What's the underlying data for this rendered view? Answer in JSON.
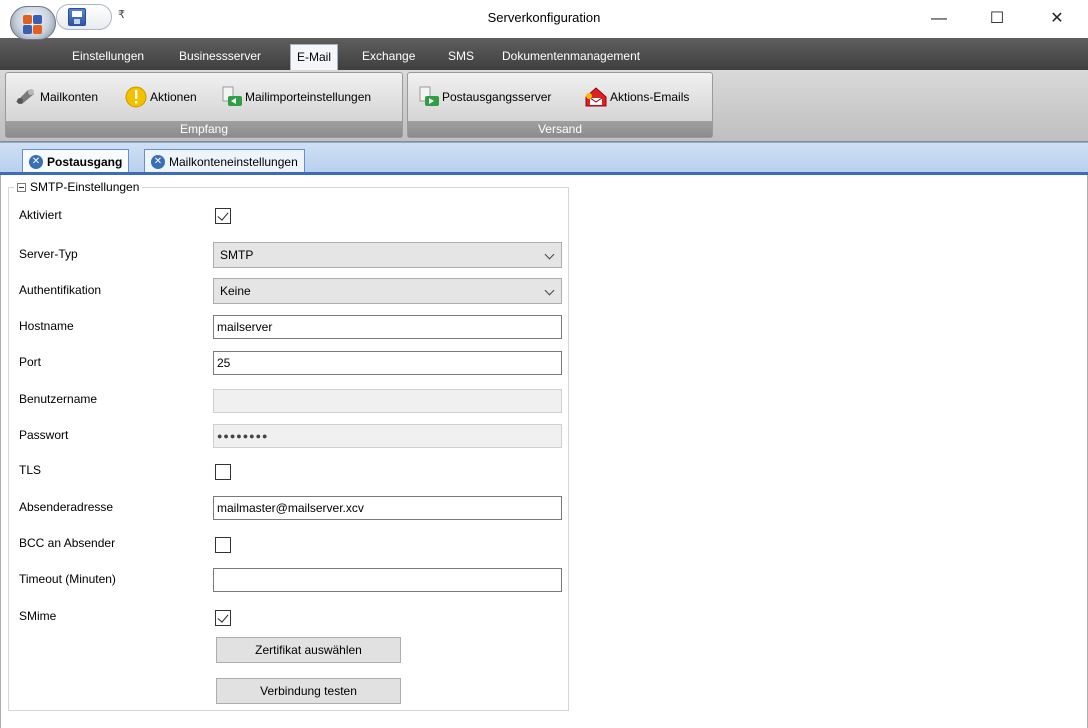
{
  "window": {
    "title": "Serverkonfiguration",
    "minimize": "—",
    "maximize": "☐",
    "close": "✕",
    "qat_dropdown": "₹"
  },
  "ribbon_tabs": [
    "Einstellungen",
    "Businessserver",
    "E-Mail",
    "Exchange",
    "SMS",
    "Dokumentenmanagement"
  ],
  "active_ribbon_tab": "E-Mail",
  "ribbon_groups": {
    "empfang": {
      "caption": "Empfang",
      "buttons": [
        "Mailkonten",
        "Aktionen",
        "Mailimporteinstellungen"
      ]
    },
    "versand": {
      "caption": "Versand",
      "buttons": [
        "Postausgangsserver",
        "Aktions-Emails"
      ]
    }
  },
  "doc_tabs": [
    "Postausgang",
    "Mailkonteneinstellungen"
  ],
  "active_doc_tab": "Postausgang",
  "smtp": {
    "legend": "SMTP-Einstellungen",
    "fields": {
      "aktiviert": {
        "label": "Aktiviert",
        "checked": true
      },
      "server_typ": {
        "label": "Server-Typ",
        "value": "SMTP"
      },
      "authentifikation": {
        "label": "Authentifikation",
        "value": "Keine"
      },
      "hostname": {
        "label": "Hostname",
        "value": "mailserver"
      },
      "port": {
        "label": "Port",
        "value": "25"
      },
      "benutzername": {
        "label": "Benutzername",
        "value": ""
      },
      "passwort": {
        "label": "Passwort",
        "value": "●●●●●●●●"
      },
      "tls": {
        "label": "TLS",
        "checked": false
      },
      "absenderadresse": {
        "label": "Absenderadresse",
        "value": "mailmaster@mailserver.xcv"
      },
      "bcc": {
        "label": "BCC an Absender",
        "checked": false
      },
      "timeout": {
        "label": "Timeout (Minuten)",
        "value": ""
      },
      "smime": {
        "label": "SMime",
        "checked": true
      }
    },
    "buttons": {
      "zertifikat": "Zertifikat auswählen",
      "verbindung": "Verbindung testen"
    }
  },
  "colors": {
    "ribbon_tabbar": "#4f4f4f",
    "doc_tab_accent": "#3d6db5",
    "group_caption": "#969696"
  }
}
